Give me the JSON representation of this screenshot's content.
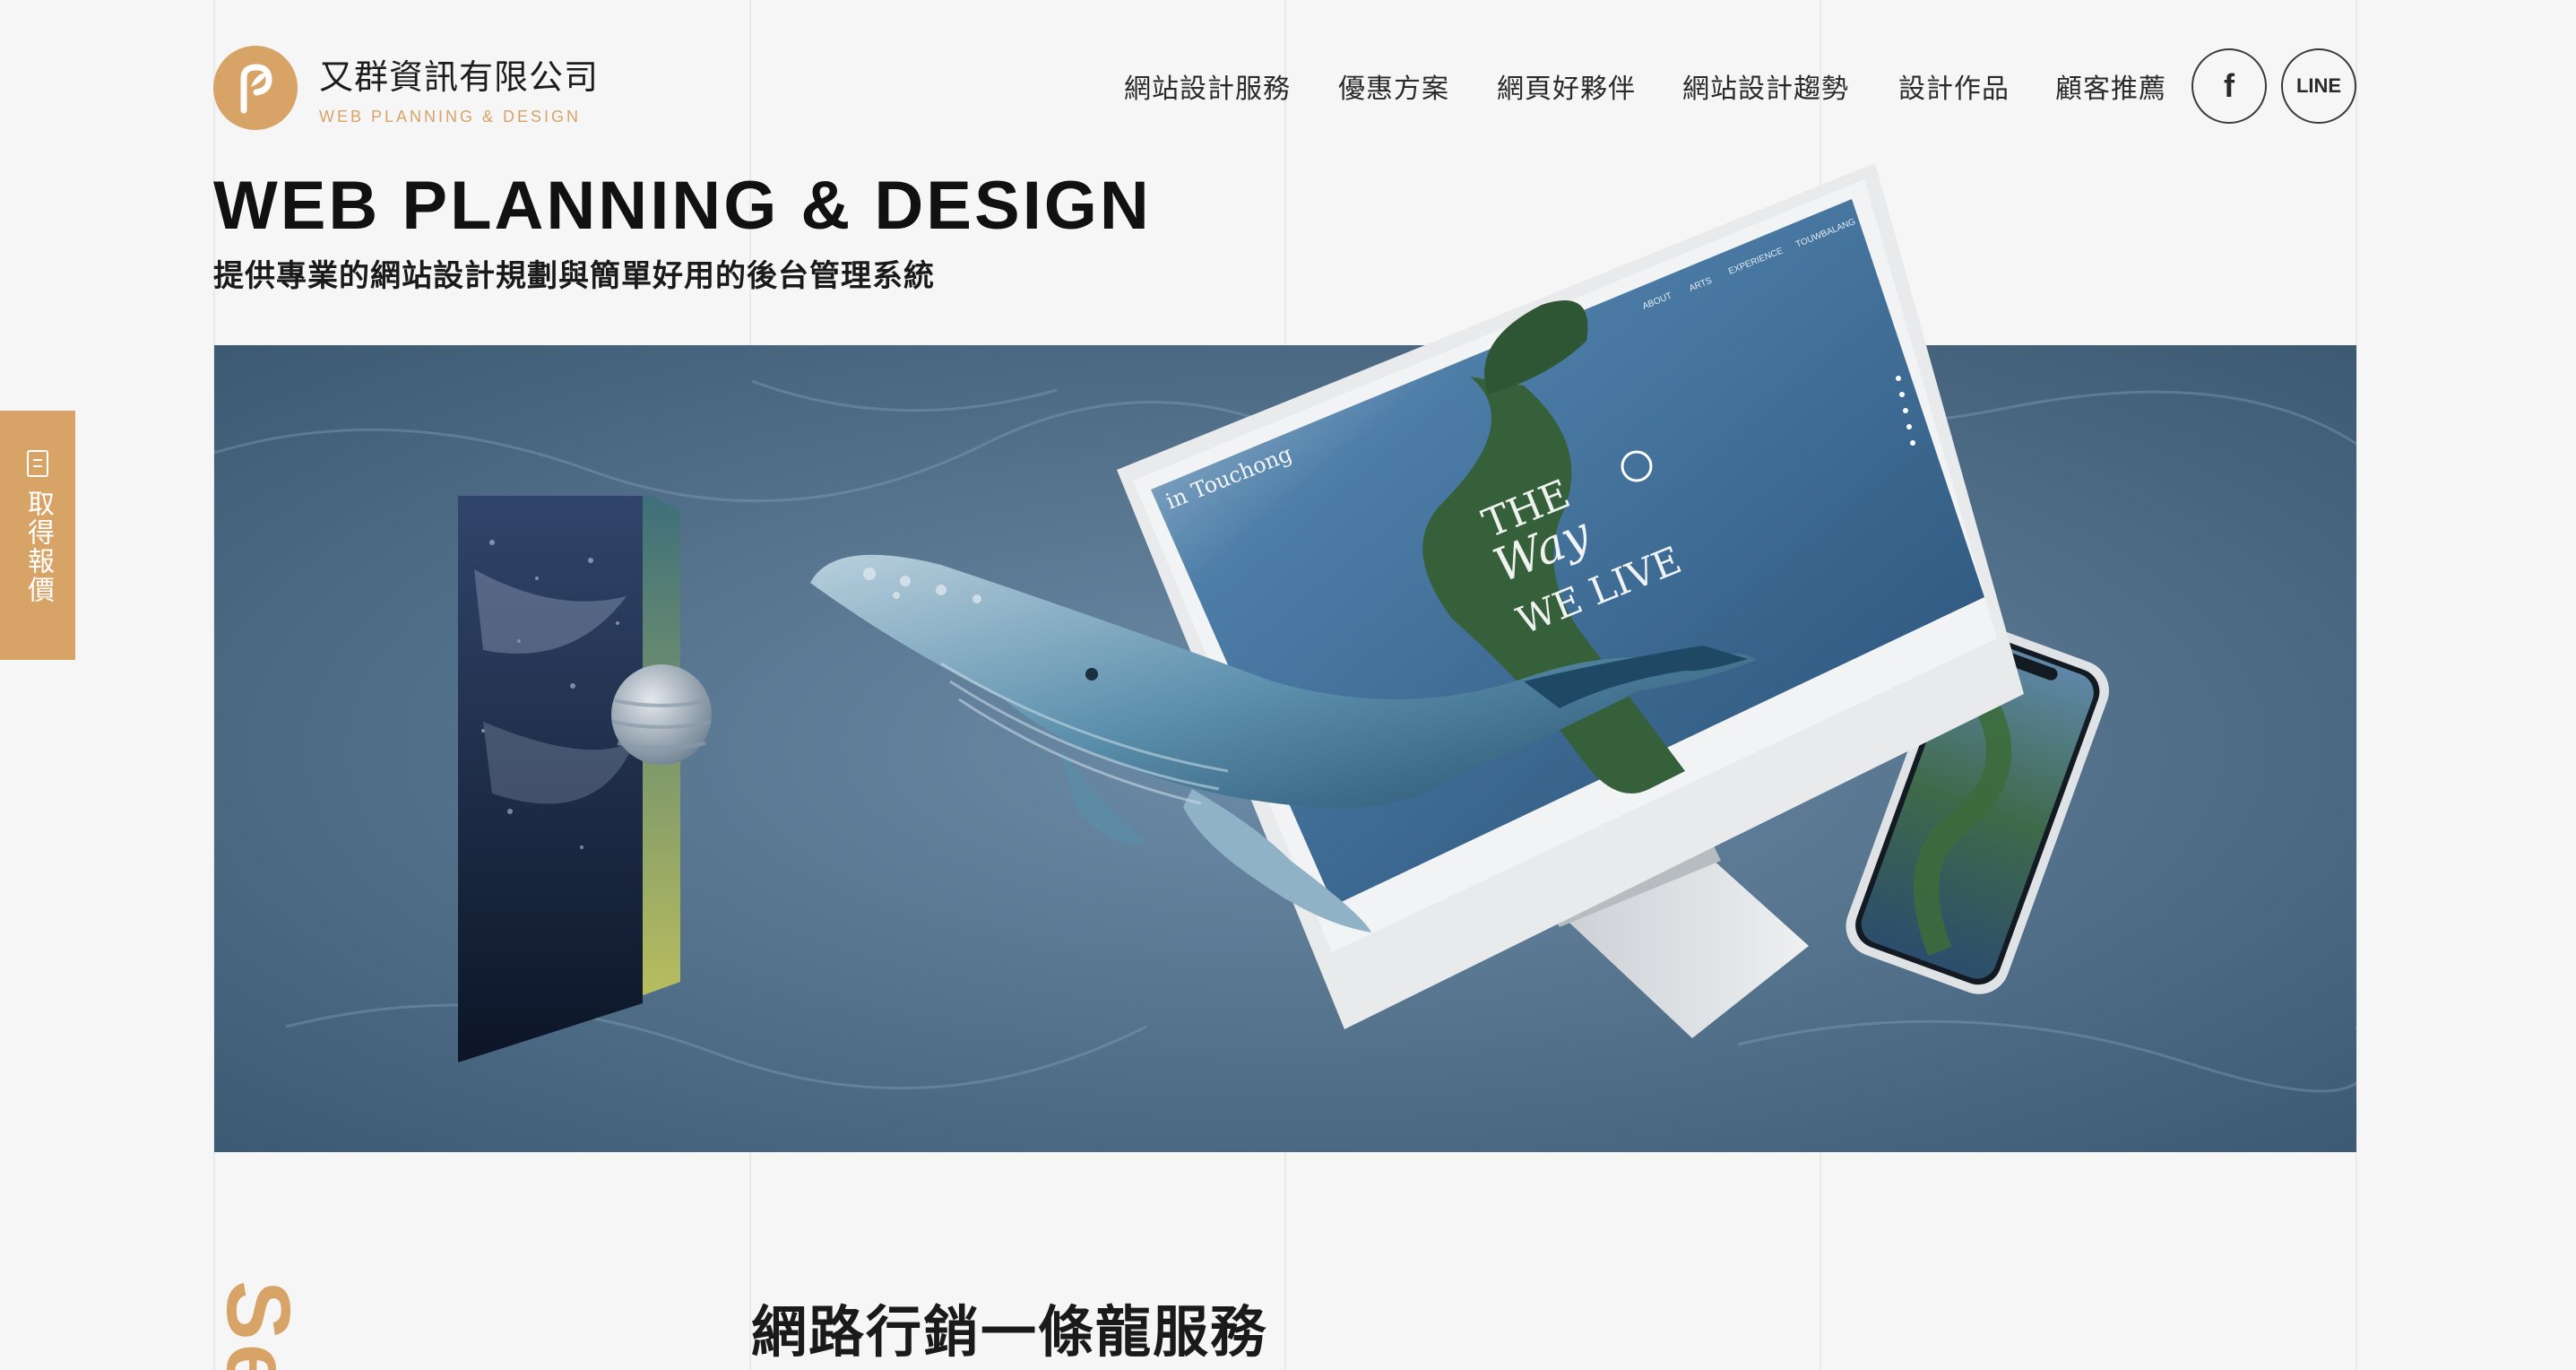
{
  "brand": {
    "name": "又群資訊有限公司",
    "tagline": "WEB PLANNING & DESIGN",
    "accent_color": "#d7a366"
  },
  "nav": {
    "items": [
      {
        "label": "網站設計服務"
      },
      {
        "label": "優惠方案"
      },
      {
        "label": "網頁好夥伴"
      },
      {
        "label": "網站設計趨勢"
      },
      {
        "label": "設計作品"
      },
      {
        "label": "顧客推薦"
      }
    ],
    "social": {
      "facebook_icon": "facebook-icon",
      "facebook_label": "f",
      "line_label": "LINE"
    }
  },
  "hero": {
    "title": "WEB PLANNING & DESIGN",
    "subtitle": "提供專業的網站設計規劃與簡單好用的後台管理系統"
  },
  "mockup": {
    "site_logo": "in Touchong",
    "headline_1": "THE",
    "headline_2": "Way",
    "headline_3": "WE LIVE",
    "menu": [
      "ABOUT",
      "ARTS",
      "EXPERIENCE",
      "TOUWBALANG"
    ]
  },
  "side_tab": {
    "label": "取得報價",
    "icon": "document-icon"
  },
  "section": {
    "heading": "網路行銷一條龍服務",
    "vertical_word": "Se"
  }
}
